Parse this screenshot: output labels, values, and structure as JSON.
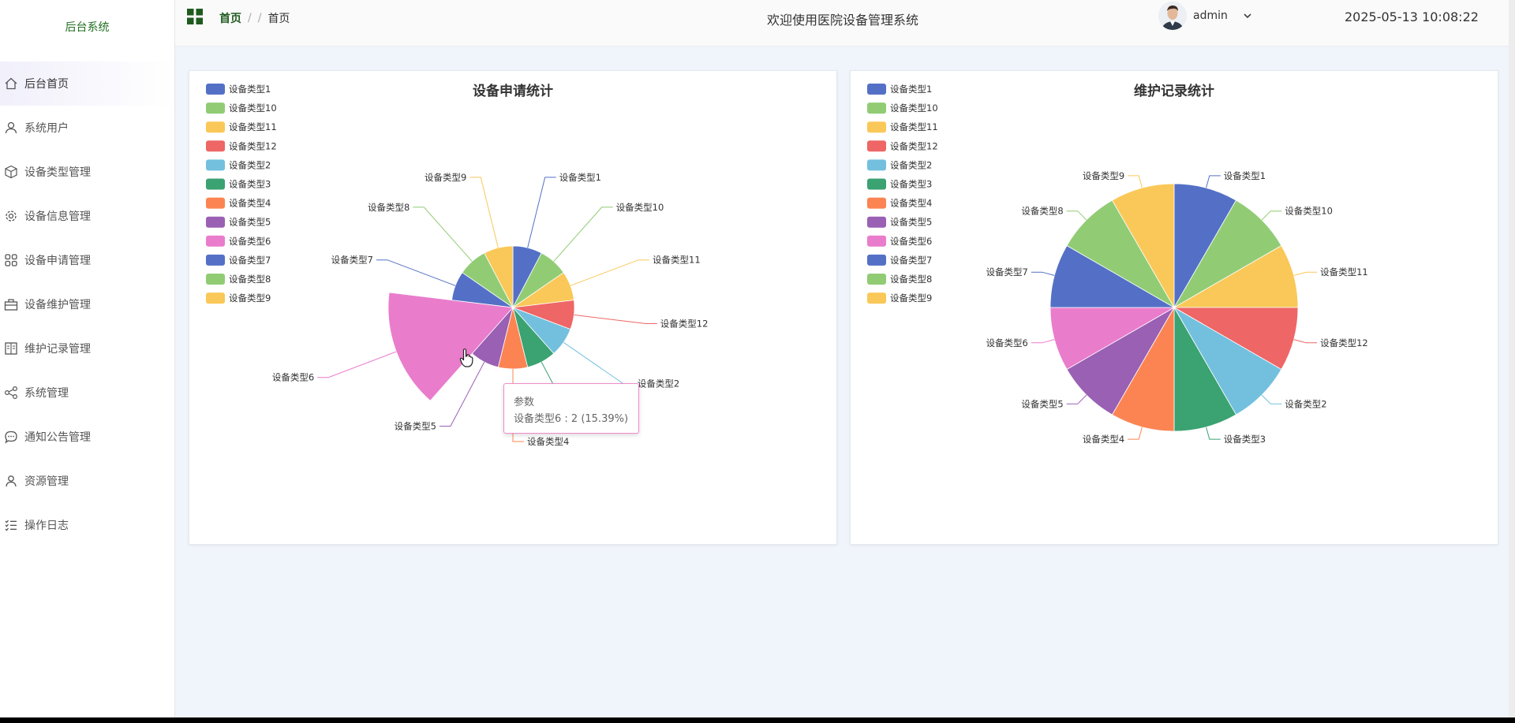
{
  "sidebar": {
    "brand": "后台系统",
    "items": [
      {
        "label": "后台首页",
        "icon": "home-icon",
        "active": true
      },
      {
        "label": "系统用户",
        "icon": "user-icon",
        "active": false
      },
      {
        "label": "设备类型管理",
        "icon": "cube-icon",
        "active": false
      },
      {
        "label": "设备信息管理",
        "icon": "gear-icon",
        "active": false
      },
      {
        "label": "设备申请管理",
        "icon": "grid-icon",
        "active": false
      },
      {
        "label": "设备维护管理",
        "icon": "toolbox-icon",
        "active": false
      },
      {
        "label": "维护记录管理",
        "icon": "book-icon",
        "active": false
      },
      {
        "label": "系统管理",
        "icon": "share-icon",
        "active": false
      },
      {
        "label": "通知公告管理",
        "icon": "chat-icon",
        "active": false
      },
      {
        "label": "资源管理",
        "icon": "person-icon",
        "active": false
      },
      {
        "label": "操作日志",
        "icon": "list-icon",
        "active": false
      }
    ]
  },
  "header": {
    "breadcrumb": {
      "home": "首页",
      "sep1": "/",
      "sep2": "/",
      "current": "首页"
    },
    "welcome": "欢迎使用医院设备管理系统",
    "username": "admin",
    "datetime": "2025-05-13 10:08:22"
  },
  "tooltip": {
    "title": "参数",
    "body": "设备类型6 : 2 (15.39%)"
  },
  "colors": [
    "#5470c6",
    "#91cc75",
    "#fac858",
    "#ee6666",
    "#73c0de",
    "#3ba272",
    "#fc8452",
    "#9a60b4",
    "#ea7ccc"
  ],
  "chart_data": [
    {
      "type": "pie",
      "title": "设备申请统计",
      "legend_position": "top-left",
      "categories": [
        "设备类型1",
        "设备类型10",
        "设备类型11",
        "设备类型12",
        "设备类型2",
        "设备类型3",
        "设备类型4",
        "设备类型5",
        "设备类型6",
        "设备类型7",
        "设备类型8",
        "设备类型9"
      ],
      "values": [
        1,
        1,
        1,
        1,
        1,
        1,
        1,
        1,
        2,
        1,
        1,
        1
      ],
      "highlighted": "设备类型6",
      "highlighted_percent": 15.39
    },
    {
      "type": "pie",
      "title": "维护记录统计",
      "legend_position": "top-left",
      "categories": [
        "设备类型1",
        "设备类型10",
        "设备类型11",
        "设备类型12",
        "设备类型2",
        "设备类型3",
        "设备类型4",
        "设备类型5",
        "设备类型6",
        "设备类型7",
        "设备类型8",
        "设备类型9"
      ],
      "values": [
        1,
        1,
        1,
        1,
        1,
        1,
        1,
        1,
        1,
        1,
        1,
        1
      ]
    }
  ]
}
